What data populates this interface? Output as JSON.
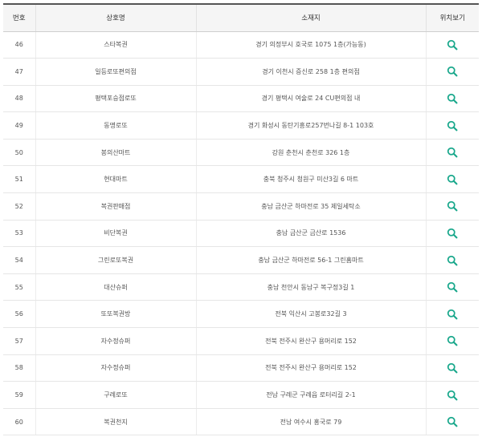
{
  "table": {
    "headers": {
      "number": "번호",
      "store_name": "상호명",
      "address": "소재지",
      "location": "위치보기"
    },
    "icon_color": "#1aa88c",
    "header_bg": "#f5f5f5",
    "rows": [
      {
        "number": "46",
        "store_name": "스타복권",
        "address": "경기 의정부시 호국로 1075 1층(가능동)"
      },
      {
        "number": "47",
        "store_name": "일등로또편의점",
        "address": "경기 이천시 증신로 258 1층 편의점"
      },
      {
        "number": "48",
        "store_name": "평택포승점로또",
        "address": "경기 평택시 여술로 24 CU편의점 내"
      },
      {
        "number": "49",
        "store_name": "동명로또",
        "address": "경기 화성시 동탄기흥로257번나길 8-1 103호"
      },
      {
        "number": "50",
        "store_name": "봉의산마트",
        "address": "강원 춘천시 춘천로 326 1층"
      },
      {
        "number": "51",
        "store_name": "현대마트",
        "address": "충북 청주시 청원구 미산3길 6 마트"
      },
      {
        "number": "52",
        "store_name": "복권판매점",
        "address": "충남 금산군 하마전로 35 제일세탁소"
      },
      {
        "number": "53",
        "store_name": "비단복권",
        "address": "충남 금산군 금산로 1536"
      },
      {
        "number": "54",
        "store_name": "그린로또복권",
        "address": "충남 금산군 하마전로 56-1 그린홈마트"
      },
      {
        "number": "55",
        "store_name": "대산슈퍼",
        "address": "충남 천안시 동남구 복구정3길 1"
      },
      {
        "number": "56",
        "store_name": "또또복권방",
        "address": "전북 익산시 고봉로32길 3"
      },
      {
        "number": "57",
        "store_name": "자수정슈퍼",
        "address": "전북 전주시 완산구 용머리로 152"
      },
      {
        "number": "58",
        "store_name": "자수정슈퍼",
        "address": "전북 전주시 완산구 용머리로 152"
      },
      {
        "number": "59",
        "store_name": "구례로또",
        "address": "전남 구례군 구례읍 로터리길 2-1"
      },
      {
        "number": "60",
        "store_name": "복권천지",
        "address": "전남 여수시 홍국로 79"
      }
    ]
  }
}
